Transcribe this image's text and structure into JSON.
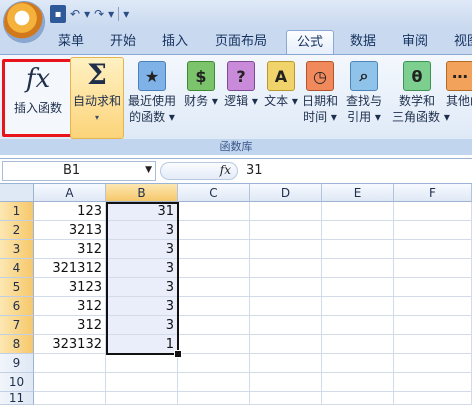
{
  "qat": {
    "save_icon": "save-icon",
    "undo_icon": "undo-icon",
    "redo_icon": "redo-icon"
  },
  "tabs": [
    {
      "label": "菜单"
    },
    {
      "label": "开始"
    },
    {
      "label": "插入"
    },
    {
      "label": "页面布局"
    },
    {
      "label": "公式",
      "active": true
    },
    {
      "label": "数据"
    },
    {
      "label": "审阅"
    },
    {
      "label": "视图"
    }
  ],
  "ribbon": {
    "insert_function": {
      "icon_text": "fx",
      "label": "插入函数"
    },
    "autosum": {
      "icon_text": "Σ",
      "label": "自动求和",
      "caret": "▾"
    },
    "recent": {
      "label1": "最近使用",
      "label2": "的函数 ▾"
    },
    "financial": {
      "label": "财务 ▾"
    },
    "logical": {
      "label": "逻辑 ▾",
      "icon_text": "?"
    },
    "text": {
      "label": "文本 ▾",
      "icon_text": "A"
    },
    "datetime": {
      "label1": "日期和",
      "label2": "时间 ▾"
    },
    "lookup": {
      "label1": "查找与",
      "label2": "引用 ▾"
    },
    "math": {
      "label1": "数学和",
      "label2": "三角函数 ▾",
      "icon_text": "θ"
    },
    "other": {
      "label1": "其他函",
      "label2": ""
    },
    "group_label": "函数库"
  },
  "formula_bar": {
    "name_box": "B1",
    "fx_label": "fx",
    "value": "31"
  },
  "grid": {
    "columns": [
      "A",
      "B",
      "C",
      "D",
      "E",
      "F"
    ],
    "rows": [
      "1",
      "2",
      "3",
      "4",
      "5",
      "6",
      "7",
      "8",
      "9",
      "10",
      "11"
    ],
    "col_a": [
      "123",
      "3213",
      "312",
      "321312",
      "3123",
      "312",
      "312",
      "323132"
    ],
    "col_b": [
      "31",
      "3",
      "3",
      "3",
      "3",
      "3",
      "3",
      "1"
    ]
  }
}
